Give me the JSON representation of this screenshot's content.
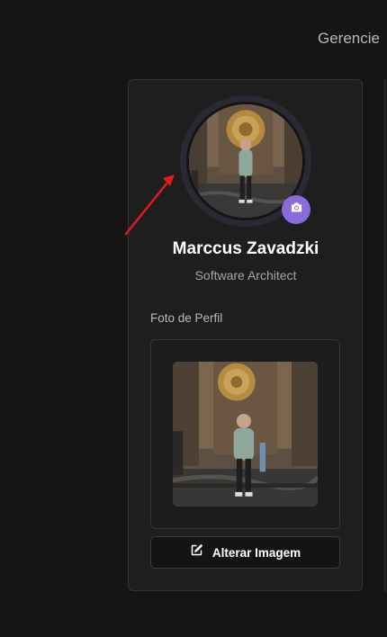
{
  "header": {
    "title": "Gerencie"
  },
  "profile": {
    "name": "Marccus Zavadzki",
    "role": "Software Architect",
    "photo_section_label": "Foto de Perfil",
    "change_image_label": "Alterar Imagem"
  },
  "icons": {
    "camera": "camera-icon",
    "edit": "edit-icon"
  },
  "colors": {
    "accent": "#8b6ad9",
    "annotation": "#e01b1b",
    "background": "#151515",
    "card": "#1e1e1e"
  }
}
